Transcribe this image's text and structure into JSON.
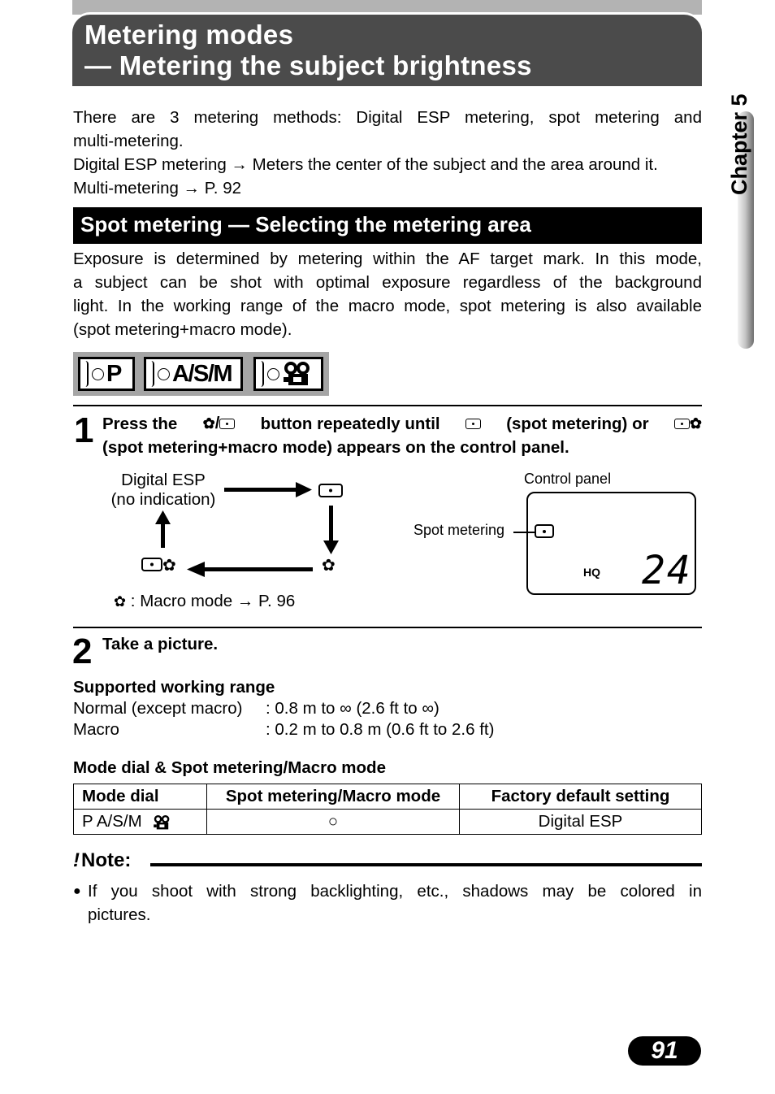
{
  "header": {
    "title_line1": "Metering modes",
    "title_line2": "— Metering the subject brightness"
  },
  "chapter_tab": {
    "label": "Chapter 5"
  },
  "intro": {
    "line1": "There are 3 metering methods: Digital ESP metering, spot metering and",
    "line2": "multi-metering.",
    "line3_prefix": "Digital ESP metering",
    "line3_arrow": "→",
    "line3_suffix": "Meters the center of the subject and the area around it.",
    "line4_prefix": "Multi-metering",
    "line4_arrow": "→",
    "line4_suffix": "P. 92"
  },
  "section": {
    "title": "Spot metering — Selecting the metering area",
    "paragraph_lines": [
      "Exposure is determined by metering within the AF target mark. In this mode,",
      "a subject can be shot with optimal exposure regardless of the background",
      "light. In the working range of the macro mode, spot metering is also available",
      "(spot metering+macro mode)."
    ]
  },
  "mode_icons": [
    {
      "label": "P",
      "icon": "mode-p-icon"
    },
    {
      "label": "A/S/M",
      "icon": "mode-asm-icon"
    },
    {
      "label": "",
      "icon": "movie-camera-icon"
    }
  ],
  "step1": {
    "number": "1",
    "text_a": "Press the",
    "text_b": "button repeatedly until",
    "text_c": "(spot metering) or",
    "text_d": "(spot metering+macro mode) appears on the control panel.",
    "separator": "/"
  },
  "diagram": {
    "start_line1": "Digital ESP",
    "start_line2": "(no indication)",
    "legend_colon": ": Macro mode",
    "legend_arrow": "→",
    "legend_ref": "P. 96"
  },
  "control_panel": {
    "caption": "Control panel",
    "pointer_label": "Spot metering",
    "quality": "HQ",
    "frames_remaining": "24"
  },
  "step2": {
    "number": "2",
    "text": "Take a picture."
  },
  "working_range": {
    "title": "Supported working range",
    "rows": [
      {
        "label": "Normal (except macro)",
        "value": ": 0.8 m to ∞ (2.6 ft to ∞)"
      },
      {
        "label": "Macro",
        "value": ": 0.2 m to 0.8 m (0.6 ft to 2.6 ft)"
      }
    ]
  },
  "mode_table": {
    "title": "Mode dial & Spot metering/Macro mode",
    "headers": [
      "Mode dial",
      "Spot metering/Macro mode",
      "Factory default setting"
    ],
    "rows": [
      {
        "mode_dial": "P A/S/M",
        "spot_macro": "○",
        "default": "Digital ESP"
      }
    ]
  },
  "note": {
    "title": "Note:",
    "bullet_line1": "If you shoot with strong backlighting, etc., shadows may be colored in",
    "bullet_line2": "pictures."
  },
  "page_number": "91"
}
